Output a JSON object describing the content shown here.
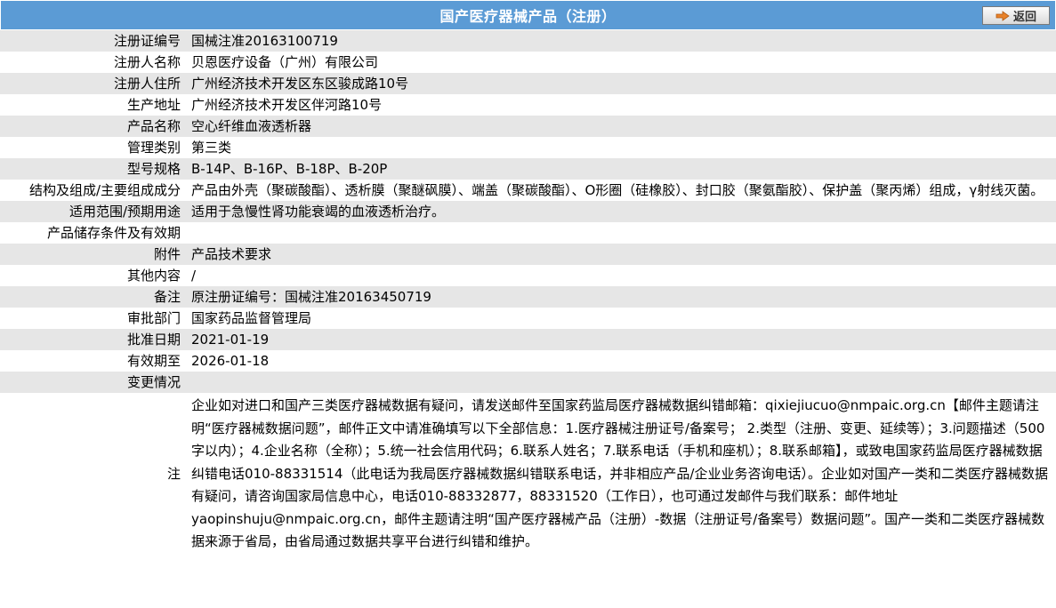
{
  "header": {
    "title": "国产医疗器械产品（注册）",
    "back_label": "返回",
    "bg_color": "#5b9bd5"
  },
  "rows": [
    {
      "label": "注册证编号",
      "value": "国械注准20163100719"
    },
    {
      "label": "注册人名称",
      "value": "贝恩医疗设备（广州）有限公司"
    },
    {
      "label": "注册人住所",
      "value": "广州经济技术开发区东区骏成路10号"
    },
    {
      "label": "生产地址",
      "value": "广州经济技术开发区伴河路10号"
    },
    {
      "label": "产品名称",
      "value": "空心纤维血液透析器"
    },
    {
      "label": "管理类别",
      "value": "第三类"
    },
    {
      "label": "型号规格",
      "value": "B-14P、B-16P、B-18P、B-20P"
    },
    {
      "label": "结构及组成/主要组成成分",
      "value": "产品由外壳（聚碳酸酯）、透析膜（聚醚砜膜）、端盖（聚碳酸酯）、O形圈（硅橡胶）、封口胶（聚氨酯胶）、保护盖（聚丙烯）组成，γ射线灭菌。"
    },
    {
      "label": "适用范围/预期用途",
      "value": "适用于急慢性肾功能衰竭的血液透析治疗。"
    },
    {
      "label": "产品储存条件及有效期",
      "value": ""
    },
    {
      "label": "附件",
      "value": "产品技术要求"
    },
    {
      "label": "其他内容",
      "value": "/"
    },
    {
      "label": "备注",
      "value": "原注册证编号：国械注准20163450719"
    },
    {
      "label": "审批部门",
      "value": "国家药品监督管理局"
    },
    {
      "label": "批准日期",
      "value": "2021-01-19"
    },
    {
      "label": "有效期至",
      "value": "2026-01-18"
    },
    {
      "label": "变更情况",
      "value": ""
    }
  ],
  "notes": {
    "label": "注",
    "text": "企业如对进口和国产三类医疗器械数据有疑问，请发送邮件至国家药监局医疗器械数据纠错邮箱：qixiejiucuo@nmpaic.org.cn【邮件主题请注明“医疗器械数据问题”，邮件正文中请准确填写以下全部信息：1.医疗器械注册证号/备案号； 2.类型（注册、变更、延续等）；3.问题描述（500字以内）；4.企业名称（全称）；5.统一社会信用代码；6.联系人姓名；7.联系电话（手机和座机）；8.联系邮箱】，或致电国家药监局医疗器械数据纠错电话010-88331514（此电话为我局医疗器械数据纠错联系电话，并非相应产品/企业业务咨询电话）。企业如对国产一类和二类医疗器械数据有疑问，请咨询国家局信息中心，电话010-88332877，88331520（工作日），也可通过发邮件与我们联系：邮件地址yaopinshuju@nmpaic.org.cn，邮件主题请注明“国产医疗器械产品（注册）-数据（注册证号/备案号）数据问题”。国产一类和二类医疗器械数据来源于省局，由省局通过数据共享平台进行纠错和维护。"
  }
}
